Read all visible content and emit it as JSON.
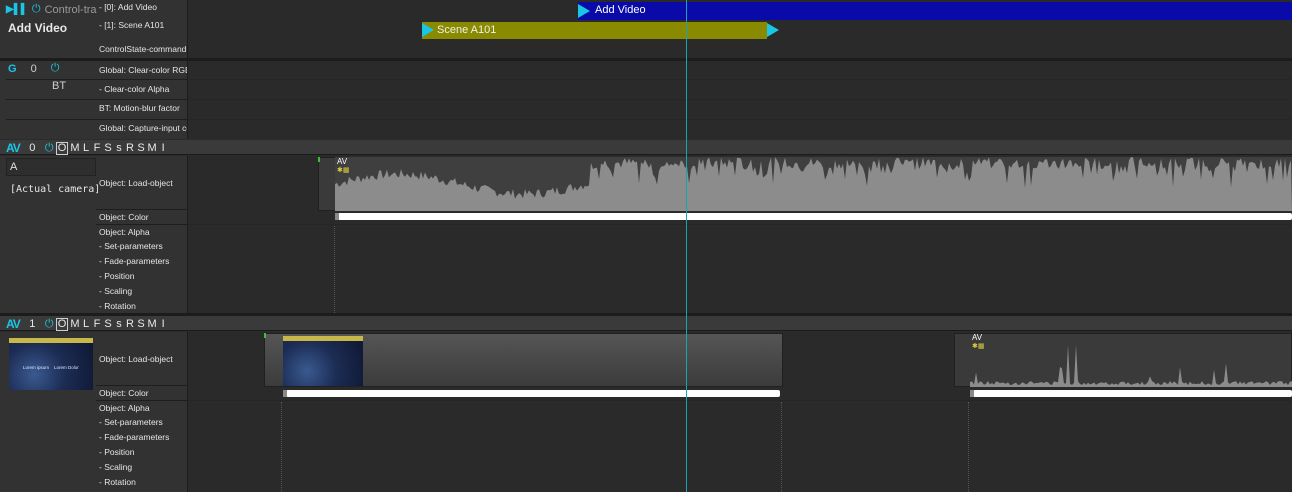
{
  "control_track": {
    "title_fragment": "Control-trac",
    "name": "Add Video",
    "labels": [
      "- [0]: Add Video",
      "- [1]: Scene A101",
      "ControlState-command"
    ],
    "events": [
      {
        "label": "Add Video",
        "color": "#0a0aa8"
      },
      {
        "label": "Scene A101",
        "color": "#8a8a00"
      }
    ]
  },
  "global_track": {
    "icon_label": "G",
    "index": "0",
    "sub_label": "BT",
    "params": [
      "Global: Clear-color RGB",
      "- Clear-color Alpha",
      "BT: Motion-blur factor",
      "Global: Capture-input co"
    ]
  },
  "av_tracks": [
    {
      "index": "0",
      "flags": [
        "O",
        "M",
        "L",
        "F",
        "S",
        "s",
        "R",
        "S",
        "M",
        "I"
      ],
      "name_field": "A",
      "caption": "[Actual camera]",
      "params": [
        "Object: Load-object",
        "Object: Color",
        "Object: Alpha",
        "- Set-parameters",
        "- Fade-parameters",
        "- Position",
        "- Scaling",
        "- Rotation"
      ],
      "clip_tag": "AV"
    },
    {
      "index": "1",
      "flags": [
        "O",
        "M",
        "L",
        "F",
        "S",
        "s",
        "R",
        "S",
        "M",
        "I"
      ],
      "params": [
        "Object: Load-object",
        "Object: Color",
        "Object: Alpha",
        "- Set-parameters",
        "- Fade-parameters",
        "- Position",
        "- Scaling",
        "- Rotation"
      ],
      "clip_tag": "AV",
      "thumb_text": [
        "Lorem ipsum",
        "Lorem Dolor"
      ]
    }
  ],
  "icons": {
    "play_pause": "play-pause-icon",
    "power": "power-icon",
    "av_logo": "AV"
  },
  "colors": {
    "accent": "#19c6e6",
    "event_blue": "#0a0aa8",
    "event_olive": "#8a8a00",
    "cursor": "#19a4b4"
  }
}
